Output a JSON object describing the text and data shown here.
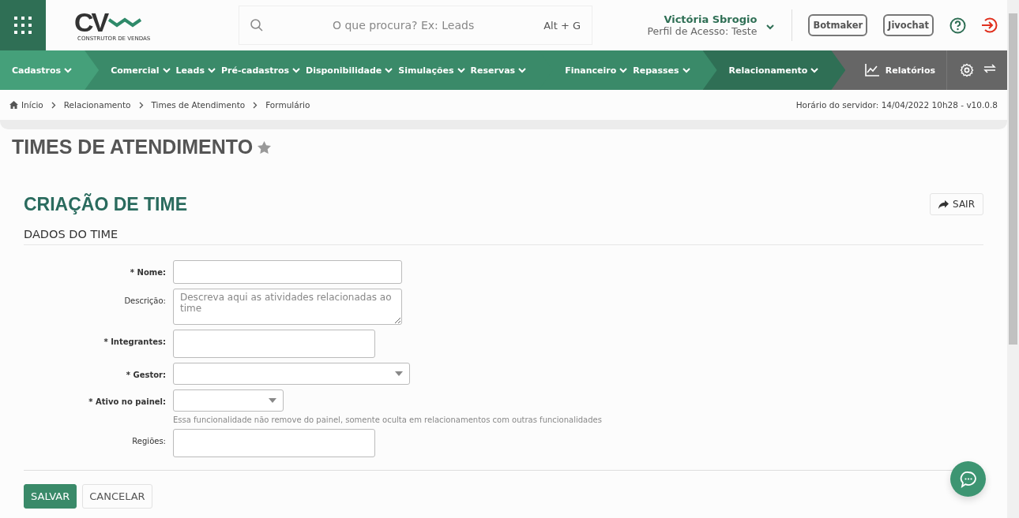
{
  "header": {
    "logo": {
      "mark": "CV",
      "tagline": "CONSTRUTOR DE VENDAS"
    },
    "search": {
      "placeholder": "O que procura? Ex: Leads",
      "shortcut": "Alt + G"
    },
    "user": {
      "name": "Victória Sbrogio",
      "profile": "Perfil de Acesso: Teste"
    },
    "buttons": [
      "Botmaker",
      "Jivochat"
    ]
  },
  "nav": {
    "groups": [
      {
        "color": "#45a07a",
        "items": [
          "Cadastros"
        ]
      },
      {
        "color": "#3a8a69",
        "items": [
          "Comercial",
          "Leads",
          "Pré-cadastros",
          "Disponibilidade",
          "Simulações",
          "Reservas"
        ]
      },
      {
        "color": "#3a8a69",
        "items": [
          "Financeiro",
          "Repasses"
        ]
      },
      {
        "color": "#2f6f55",
        "items": [
          "Relacionamento"
        ]
      }
    ],
    "reports": "Relatórios"
  },
  "breadcrumb": {
    "items": [
      "Início",
      "Relacionamento",
      "Times de Atendimento",
      "Formulário"
    ],
    "server_time": "Horário do servidor: 14/04/2022 10h28 - v10.0.8"
  },
  "page_title": "TIMES DE ATENDIMENTO",
  "favorite": false,
  "form": {
    "title": "CRIAÇÃO DE TIME",
    "required_mark": "*",
    "exit_button": "SAIR",
    "section": "DADOS DO TIME",
    "fields": [
      {
        "kind": "text",
        "label": "Nome:",
        "required": true
      },
      {
        "kind": "textarea",
        "label": "Descrição:",
        "required": false,
        "placeholder": "Descreva aqui as atividades relacionadas ao time"
      },
      {
        "kind": "tags",
        "label": "Integrantes:",
        "required": true
      },
      {
        "kind": "select",
        "label": "Gestor:",
        "required": true
      },
      {
        "kind": "select-small",
        "label": "Ativo no painel:",
        "required": true,
        "hint": "Essa funcionalidade não remove do painel, somente oculta em relacionamentos com outras funcionalidades"
      },
      {
        "kind": "tags",
        "label": "Regiões:",
        "required": false
      }
    ],
    "buttons": [
      {
        "label": "SALVAR",
        "kind": "primary"
      },
      {
        "label": "CANCELAR",
        "kind": "secondary"
      }
    ]
  }
}
